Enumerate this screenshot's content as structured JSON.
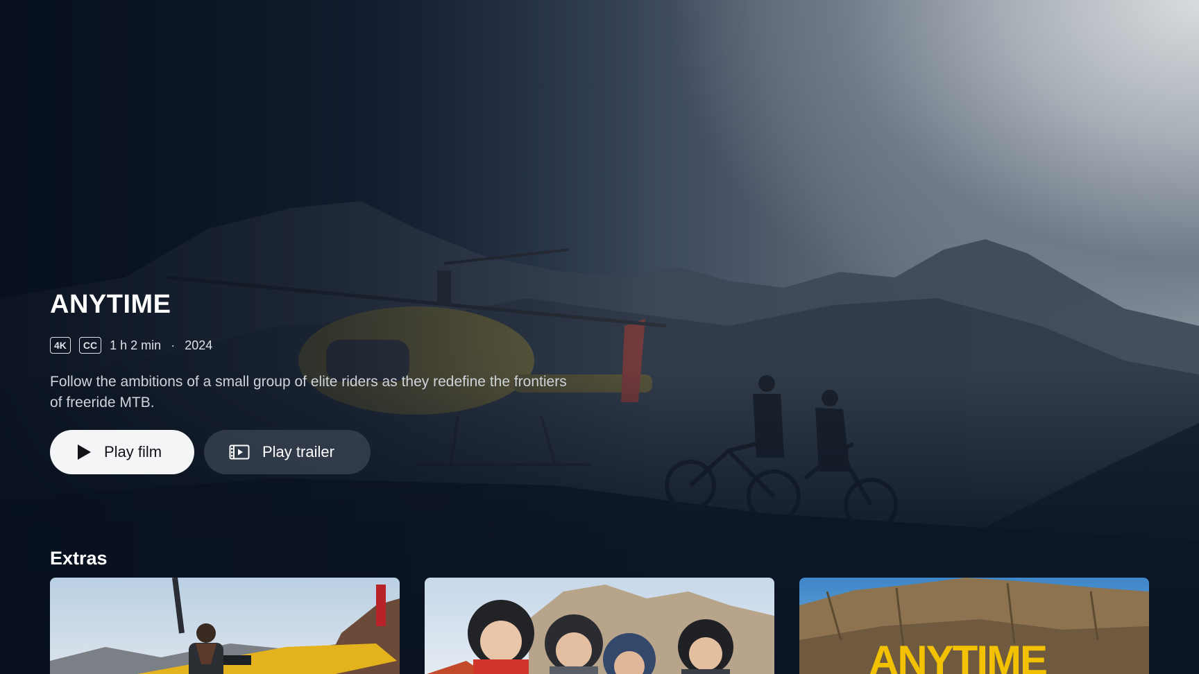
{
  "film": {
    "title": "ANYTIME",
    "badges": [
      "4K",
      "CC"
    ],
    "duration": "1 h 2 min",
    "separator": "·",
    "year": "2024",
    "description": "Follow the ambitions of a small group of elite riders as they redefine the frontiers of freeride MTB."
  },
  "actions": {
    "play_film_label": "Play film",
    "play_trailer_label": "Play trailer",
    "play_film_icon": "play-icon",
    "play_trailer_icon": "film-icon"
  },
  "extras": {
    "heading": "Extras",
    "items": [
      {
        "thumb_text": "",
        "scene": "pilot-helicopter"
      },
      {
        "thumb_text": "",
        "scene": "riders-helmets"
      },
      {
        "thumb_text": "ANYTIME",
        "scene": "title-card"
      }
    ]
  },
  "colors": {
    "background": "#0b1526",
    "primary_button": "#f4f5f7",
    "secondary_button": "#3c4654",
    "title_card_text": "#f2c200"
  }
}
